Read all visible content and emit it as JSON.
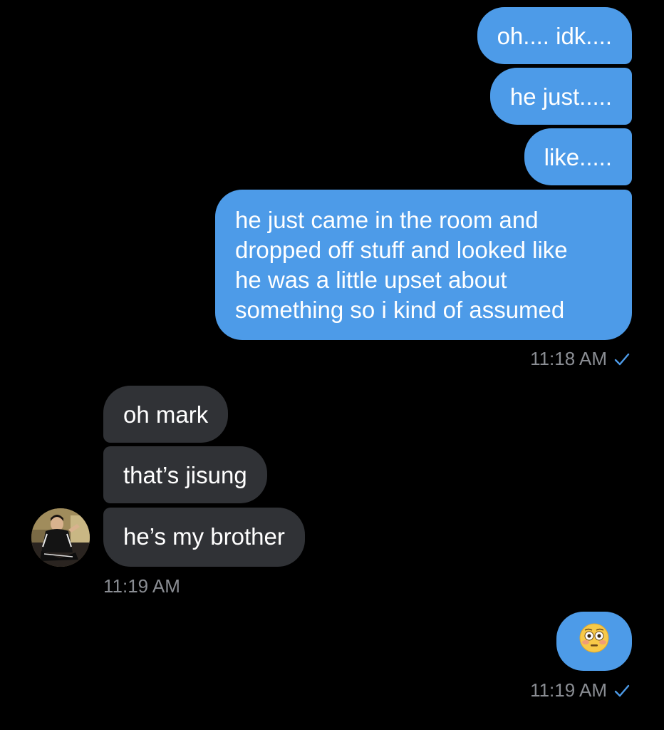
{
  "conversation": {
    "outgoing_group_1": [
      "oh.... idk....",
      "he just.....",
      "like.....",
      "he just came in the room and dropped off stuff and looked like he was a little upset about something so i kind of assumed"
    ],
    "outgoing_group_1_lines": [
      "he just came in the room and",
      "dropped off stuff and looked like",
      "he was a little upset about",
      "something so i kind of assumed"
    ],
    "outgoing_group_1_time": "11:18 AM",
    "incoming_group": [
      "oh mark",
      "that’s jisung",
      "he’s my brother"
    ],
    "incoming_group_time": "11:19 AM",
    "outgoing_group_2_emoji": "flushed-face",
    "outgoing_group_2_time": "11:19 AM"
  },
  "colors": {
    "background": "#000000",
    "outgoing_bubble": "#4d9be8",
    "incoming_bubble": "#303236",
    "timestamp": "#8a8d93",
    "read_check": "#4d9be8"
  }
}
